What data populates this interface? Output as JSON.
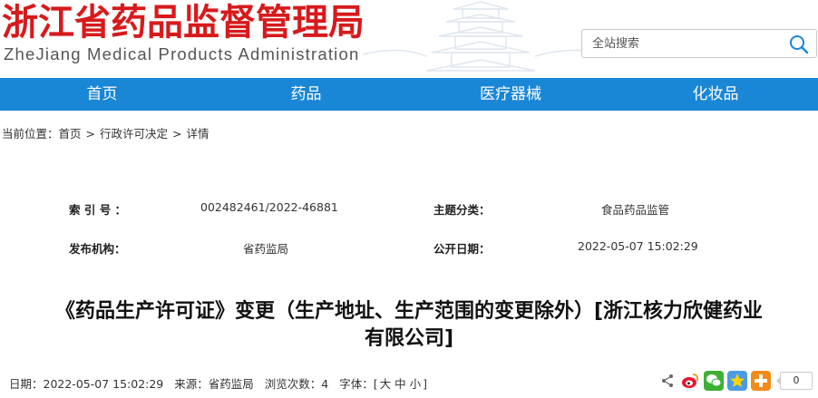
{
  "header": {
    "title": "浙江省药品监督管理局",
    "subtitle": "ZheJiang Medical Products Administration",
    "search_placeholder": "全站搜索"
  },
  "nav": {
    "items": [
      "首页",
      "药品",
      "医疗器械",
      "化妆品"
    ]
  },
  "breadcrumb": {
    "prefix": "当前位置：",
    "items": [
      "首页",
      "行政许可决定",
      "详情"
    ],
    "separator": ">"
  },
  "meta": {
    "index_label": "索 引 号 ：",
    "index_value": "002482461/2022-46881",
    "topic_label": "主题分类：",
    "topic_value": "食品药品监管",
    "publisher_label": "发布机构：",
    "publisher_value": "省药监局",
    "date_label": "公开日期：",
    "date_value": "2022-05-07 15:02:29"
  },
  "article": {
    "title_line1": "《药品生产许可证》变更（生产地址、生产范围的变更除外）[浙江核力欣健药业",
    "title_line2": "有限公司]"
  },
  "info": {
    "date": "日期：2022-05-07 15:02:29",
    "source": "来源：省药监局",
    "views": "浏览次数：4",
    "font_label": "字体：[",
    "font_large": "大",
    "font_medium": "中",
    "font_small": "小",
    "font_end": "]"
  },
  "share": {
    "count": "0"
  },
  "colors": {
    "brand_red": "#d71a1c",
    "nav_blue": "#1a86d6"
  },
  "icons": {
    "search": "search-icon",
    "share": "share-icon",
    "weibo": "weibo-icon",
    "wechat": "wechat-icon",
    "qzone": "qzone-icon",
    "more": "plus-icon"
  }
}
